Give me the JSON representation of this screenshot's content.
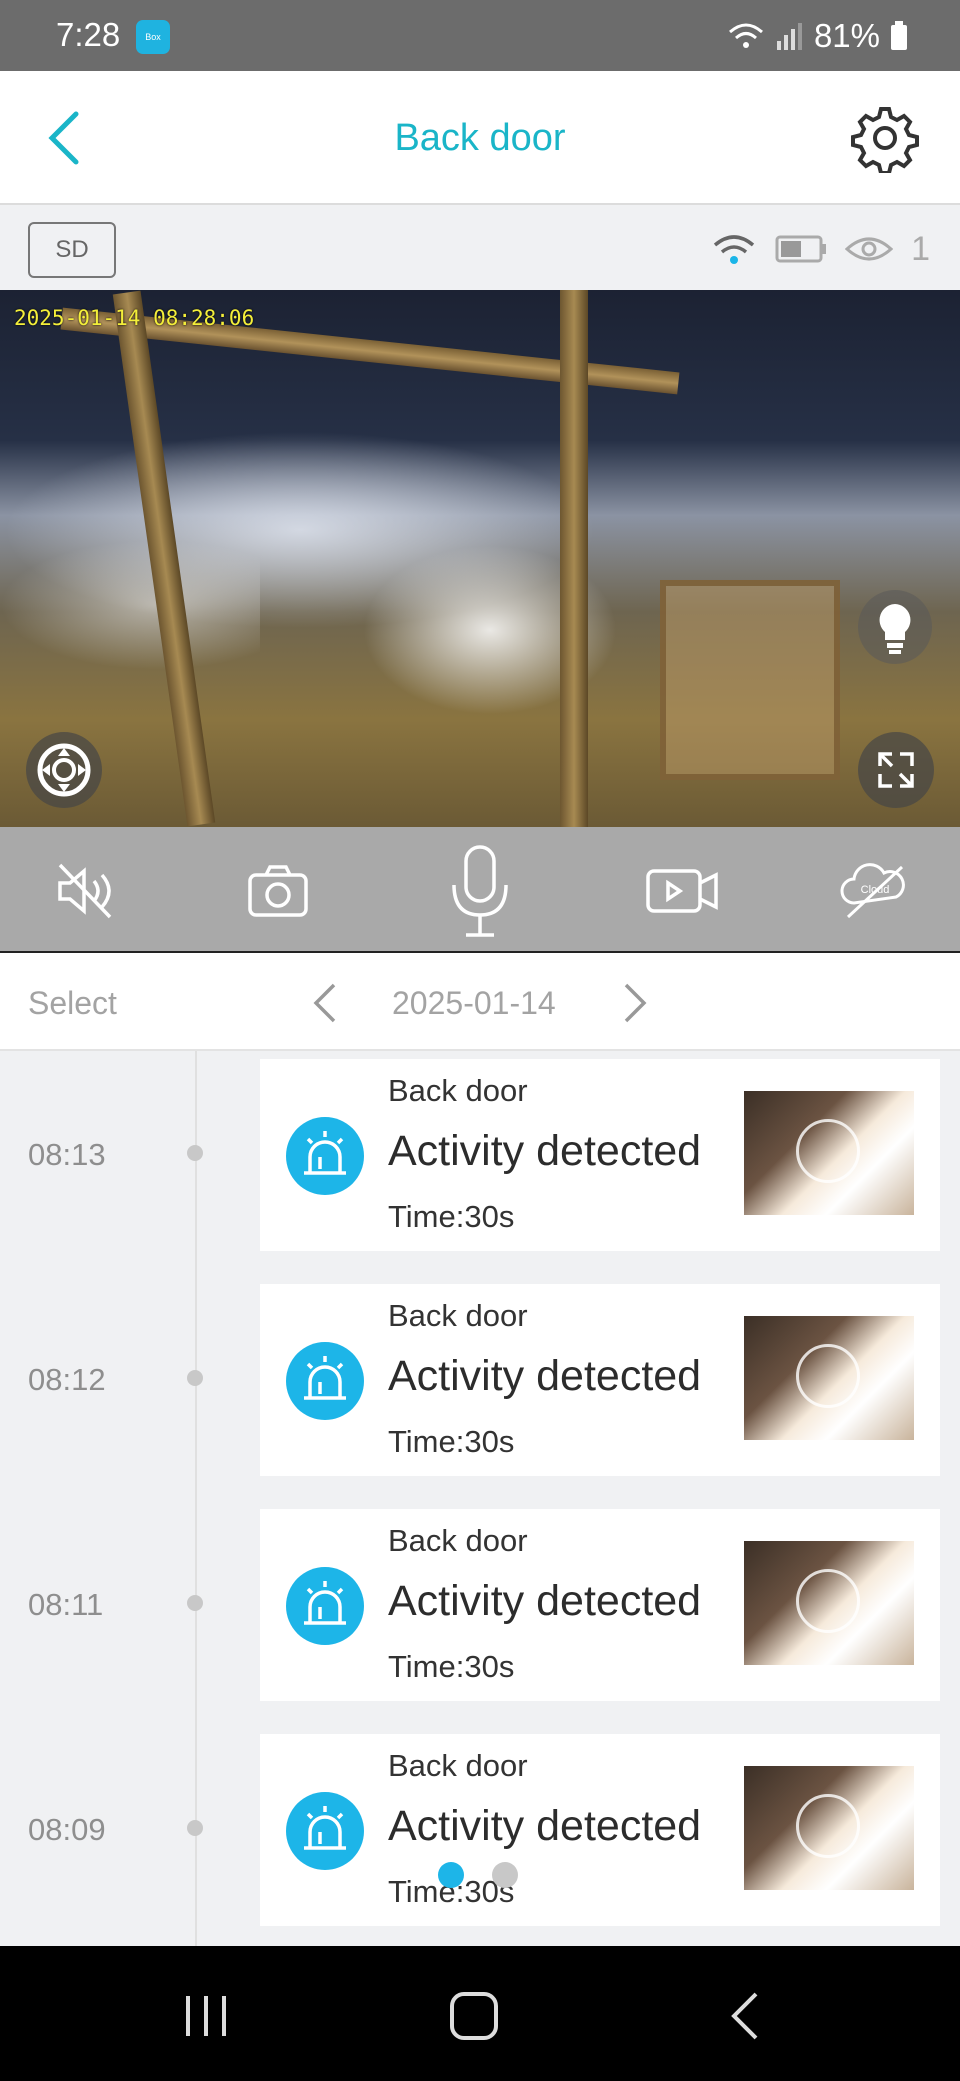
{
  "status_bar": {
    "time": "7:28",
    "app_badge": "Box",
    "battery": "81%"
  },
  "header": {
    "title": "Back door"
  },
  "status_strip": {
    "quality": "SD",
    "viewers": "1"
  },
  "video": {
    "timestamp": "2025-01-14 08:28:06"
  },
  "date_nav": {
    "select_label": "Select",
    "date": "2025-01-14"
  },
  "events": [
    {
      "time": "08:13",
      "camera": "Back door",
      "title": "Activity detected",
      "duration": "Time:30s"
    },
    {
      "time": "08:12",
      "camera": "Back door",
      "title": "Activity detected",
      "duration": "Time:30s"
    },
    {
      "time": "08:11",
      "camera": "Back door",
      "title": "Activity detected",
      "duration": "Time:30s"
    },
    {
      "time": "08:09",
      "camera": "Back door",
      "title": "Activity detected",
      "duration": "Time:30s"
    }
  ],
  "controls": {
    "mute": "speaker-muted-icon",
    "snapshot": "camera-icon",
    "talk": "microphone-icon",
    "record": "video-record-icon",
    "cloud": "cloud-icon",
    "cloud_label": "Cloud"
  },
  "colors": {
    "accent": "#1ab5c8",
    "alarm": "#1db5e8",
    "pager_active": "#1db5e8",
    "pager_inactive": "#c8c8c8"
  }
}
